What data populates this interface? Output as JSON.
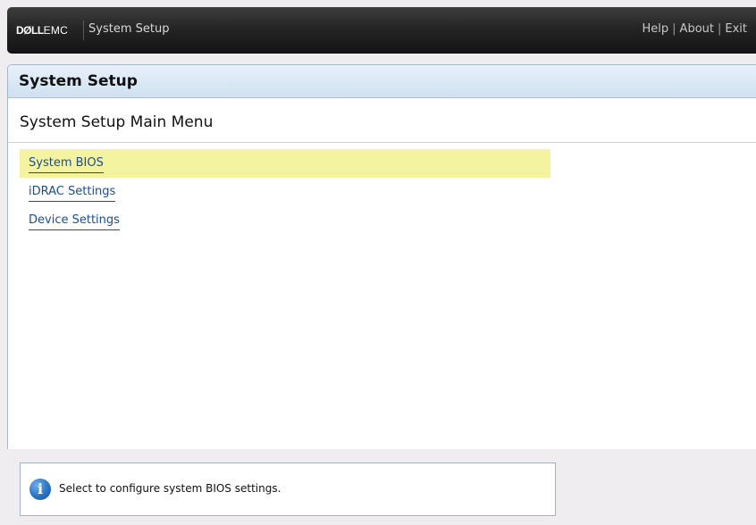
{
  "header": {
    "brand_main": "DØLL",
    "brand_sub": "EMC",
    "app_title": "System Setup",
    "links": [
      "Help",
      "About",
      "Exit"
    ],
    "separator": "|"
  },
  "panel": {
    "title": "System Setup",
    "subtitle": "System Setup Main Menu"
  },
  "menu": {
    "items": [
      {
        "label": "System BIOS",
        "selected": true
      },
      {
        "label": "iDRAC Settings",
        "selected": false
      },
      {
        "label": "Device Settings",
        "selected": false
      }
    ]
  },
  "help": {
    "icon": "info-icon",
    "text": "Select to configure system BIOS settings."
  },
  "colors": {
    "selected_bg": "#f4f3a0",
    "link": "#1a4f8c",
    "header_bar": "#141414"
  }
}
